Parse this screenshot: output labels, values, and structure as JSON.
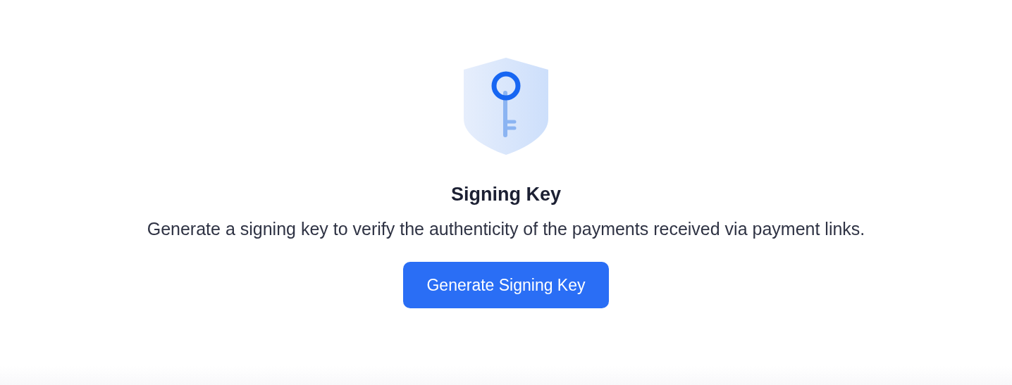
{
  "title": "Signing Key",
  "description": "Generate a signing key to verify the authenticity of the payments received via payment links.",
  "button": "Generate Signing Key"
}
